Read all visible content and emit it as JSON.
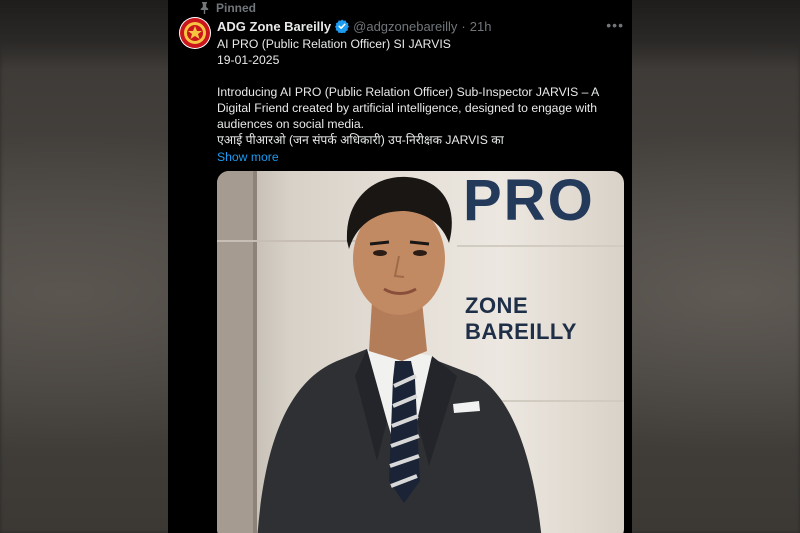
{
  "pinned": {
    "label": "Pinned"
  },
  "author": {
    "display_name": "ADG Zone Bareilly",
    "handle": "@adgzonebareilly",
    "separator": "·",
    "time": "21h"
  },
  "tweet": {
    "lines_a": [
      "AI PRO (Public Relation Officer) SI JARVIS",
      "19-01-2025"
    ],
    "lines_b": [
      "Introducing AI PRO (Public Relation Officer) Sub-Inspector JARVIS – A",
      "Digital Friend created by artificial intelligence, designed to engage with",
      "audiences on social media.",
      "एआई पीआरओ (जन संपर्क अधिकारी) उप-निरीक्षक JARVIS का"
    ],
    "show_more": "Show more"
  },
  "media": {
    "wall_text_top": "PRO",
    "wall_text_sign": "ZONE BAREILLY"
  },
  "icons": {
    "pin": "pin-icon",
    "verified": "verified-badge-icon",
    "more": "more-options-icon"
  },
  "colors": {
    "accent": "#1d9bf0",
    "text": "#e7e9ea",
    "muted": "#71767b"
  }
}
